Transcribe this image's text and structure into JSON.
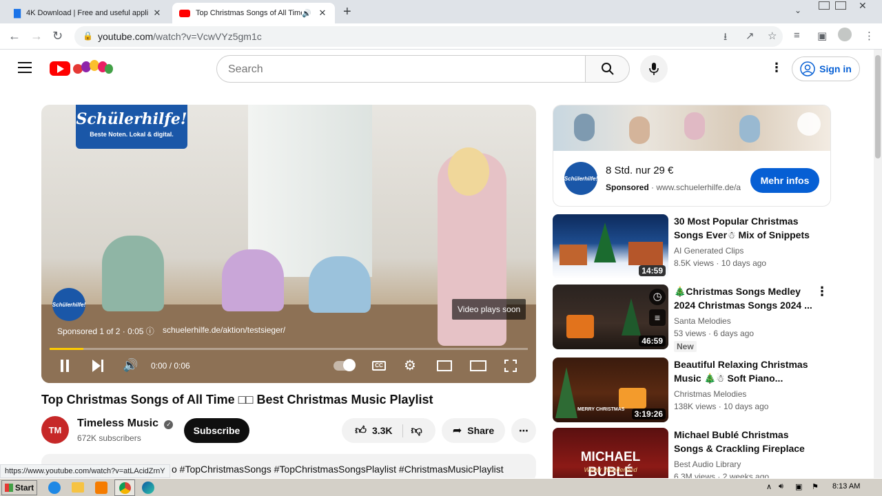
{
  "browser": {
    "tabs": [
      {
        "title": "4K Download | Free and useful appli"
      },
      {
        "title": "Top Christmas Songs of All Time"
      }
    ],
    "url_host": "youtube.com",
    "url_path": "/watch?v=VcwVYz5gm1c",
    "status_url": "https://www.youtube.com/watch?v=atLAcidZrnY"
  },
  "header": {
    "search_placeholder": "Search",
    "signin_label": "Sign in"
  },
  "player": {
    "ad_brand": "Schülerhilfe!",
    "ad_tagline": "Beste Noten. Lokal & digital.",
    "ad_badge_text": "Schülerhilfe!",
    "video_plays_soon": "Video plays soon",
    "sponsored_info": "Sponsored 1 of 2 · 0:05",
    "ad_url": "schuelerhilfe.de/aktion/testsieger/",
    "time": "0:00 / 0:06",
    "progress_fraction": 0.07
  },
  "video": {
    "title": "Top Christmas Songs of All Time □□ Best Christmas Music Playlist",
    "channel_name": "Timeless Music",
    "channel_initials": "TM",
    "subscribers": "672K subscribers",
    "subscribe_label": "Subscribe",
    "likes": "3.3K",
    "share_label": "Share",
    "description_snippet": "o #TopChristmasSongs #TopChristmasSongsPlaylist #ChristmasMusicPlaylist"
  },
  "ad_card": {
    "headline": "8 Std. nur 29 €",
    "sponsored_label": "Sponsored",
    "domain": "www.schuelerhilfe.de/a",
    "cta": "Mehr infos",
    "logo_text": "Schülerhilfe!"
  },
  "recommendations": [
    {
      "title": "30 Most Popular Christmas Songs Ever☃ Mix of Snippets ...",
      "channel": "AI Generated Clips",
      "views": "8.5K views",
      "age": "10 days ago",
      "duration": "14:59",
      "badge": ""
    },
    {
      "title": "🎄Christmas Songs Medley 2024 Christmas Songs 2024 ...",
      "channel": "Santa Melodies",
      "views": "53 views",
      "age": "6 days ago",
      "duration": "46:59",
      "badge": "New"
    },
    {
      "title": "Beautiful Relaxing Christmas Music 🎄☃ Soft Piano...",
      "channel": "Christmas Melodies",
      "views": "138K views",
      "age": "10 days ago",
      "duration": "3:19:26",
      "badge": ""
    },
    {
      "title": "Michael Bublé Christmas Songs & Crackling Fireplace 🎄🔥 ...",
      "channel": "Best Audio Library",
      "views": "6.3M views",
      "age": "2 weeks ago",
      "duration": "",
      "badge": "",
      "thumb_text": "MICHAEL BUBLÉ",
      "thumb_sub": "Winter Wonderland"
    }
  ],
  "thumb_texts": {
    "merry_christmas": "MERRY CHRISTMAS"
  },
  "taskbar": {
    "start_label": "Start",
    "clock": "8:13 AM"
  }
}
